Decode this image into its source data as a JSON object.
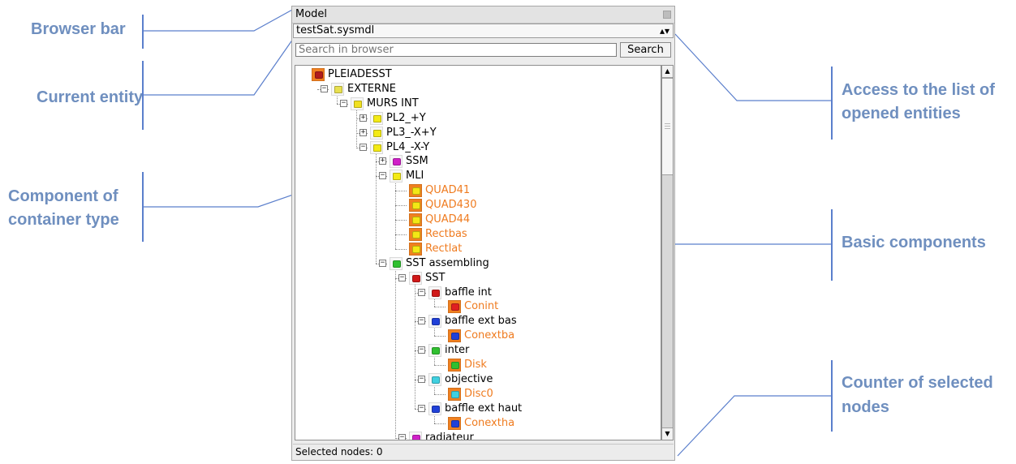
{
  "annotations": {
    "browser_bar": "Browser bar",
    "current_entity": "Current entity",
    "component_container_1": "Component of",
    "component_container_2": "container type",
    "access_list_1": "Access to the list of",
    "access_list_2": "opened entities",
    "basic_components": "Basic components",
    "counter_1": "Counter of selected",
    "counter_2": "nodes"
  },
  "panel": {
    "title": "Model",
    "current_entity": "testSat.sysmdl",
    "search_placeholder": "Search in browser",
    "search_button": "Search",
    "status": "Selected nodes: 0"
  },
  "colors": {
    "annotation_text": "#6f8fbf",
    "annotation_line": "#5b7fcc",
    "basic_label": "#ef7b1f",
    "basic_highlight": "#f08020"
  },
  "tree": [
    {
      "label": "PLEIADESST",
      "depth": 0,
      "toggle": "none",
      "icon": "component",
      "color": "#b01c1c",
      "basic": false
    },
    {
      "label": "EXTERNE",
      "depth": 1,
      "toggle": "minus",
      "icon": "folder",
      "color": "#e8e050",
      "basic": false
    },
    {
      "label": "MURS INT",
      "depth": 2,
      "toggle": "minus",
      "icon": "folder",
      "color": "#f0e020",
      "basic": false
    },
    {
      "label": "PL2_+Y",
      "depth": 3,
      "toggle": "plus",
      "icon": "folder",
      "color": "#f3ea15",
      "basic": false
    },
    {
      "label": "PL3_-X+Y",
      "depth": 3,
      "toggle": "plus",
      "icon": "folder",
      "color": "#f3ea15",
      "basic": false
    },
    {
      "label": "PL4_-X-Y",
      "depth": 3,
      "toggle": "minus",
      "icon": "folder",
      "color": "#f3ea15",
      "basic": false
    },
    {
      "label": "SSM",
      "depth": 4,
      "toggle": "plus",
      "icon": "component",
      "color": "#d020c8",
      "basic": false
    },
    {
      "label": "MLI",
      "depth": 4,
      "toggle": "minus",
      "icon": "folder",
      "color": "#f3ea15",
      "basic": false
    },
    {
      "label": "QUAD41",
      "depth": 5,
      "toggle": "leaf",
      "icon": "cube",
      "color": "#f3e815",
      "basic": true
    },
    {
      "label": "QUAD430",
      "depth": 5,
      "toggle": "leaf",
      "icon": "cube",
      "color": "#f3e815",
      "basic": true
    },
    {
      "label": "QUAD44",
      "depth": 5,
      "toggle": "leaf",
      "icon": "cube",
      "color": "#f3e815",
      "basic": true
    },
    {
      "label": "Rectbas",
      "depth": 5,
      "toggle": "leaf",
      "icon": "cube",
      "color": "#f3e815",
      "basic": true
    },
    {
      "label": "Rectlat",
      "depth": 5,
      "toggle": "leaf",
      "icon": "cube",
      "color": "#f3e815",
      "basic": true
    },
    {
      "label": "SST assembling",
      "depth": 4,
      "toggle": "minus",
      "icon": "component",
      "color": "#30c030",
      "basic": false
    },
    {
      "label": "SST",
      "depth": 5,
      "toggle": "minus",
      "icon": "component",
      "color": "#d01818",
      "basic": false
    },
    {
      "label": "baffle int",
      "depth": 6,
      "toggle": "minus",
      "icon": "component",
      "color": "#d01818",
      "basic": false
    },
    {
      "label": "Conint",
      "depth": 7,
      "toggle": "leaf",
      "icon": "cube",
      "color": "#e02020",
      "basic": true
    },
    {
      "label": "baffle ext bas",
      "depth": 6,
      "toggle": "minus",
      "icon": "component",
      "color": "#2040d8",
      "basic": false
    },
    {
      "label": "Conextba",
      "depth": 7,
      "toggle": "leaf",
      "icon": "cube",
      "color": "#2040d8",
      "basic": true
    },
    {
      "label": "inter",
      "depth": 6,
      "toggle": "minus",
      "icon": "component",
      "color": "#30c030",
      "basic": false
    },
    {
      "label": "Disk",
      "depth": 7,
      "toggle": "leaf",
      "icon": "cube",
      "color": "#30c030",
      "basic": true
    },
    {
      "label": "objective",
      "depth": 6,
      "toggle": "minus",
      "icon": "component",
      "color": "#40d0e0",
      "basic": false
    },
    {
      "label": "Disc0",
      "depth": 7,
      "toggle": "leaf",
      "icon": "cube",
      "color": "#40d0e0",
      "basic": true
    },
    {
      "label": "baffle ext haut",
      "depth": 6,
      "toggle": "minus",
      "icon": "component",
      "color": "#2040d8",
      "basic": false
    },
    {
      "label": "Conextha",
      "depth": 7,
      "toggle": "leaf",
      "icon": "cube",
      "color": "#2040d8",
      "basic": true
    },
    {
      "label": "radiateur",
      "depth": 5,
      "toggle": "minus",
      "icon": "component",
      "color": "#d020c8",
      "basic": false
    }
  ]
}
